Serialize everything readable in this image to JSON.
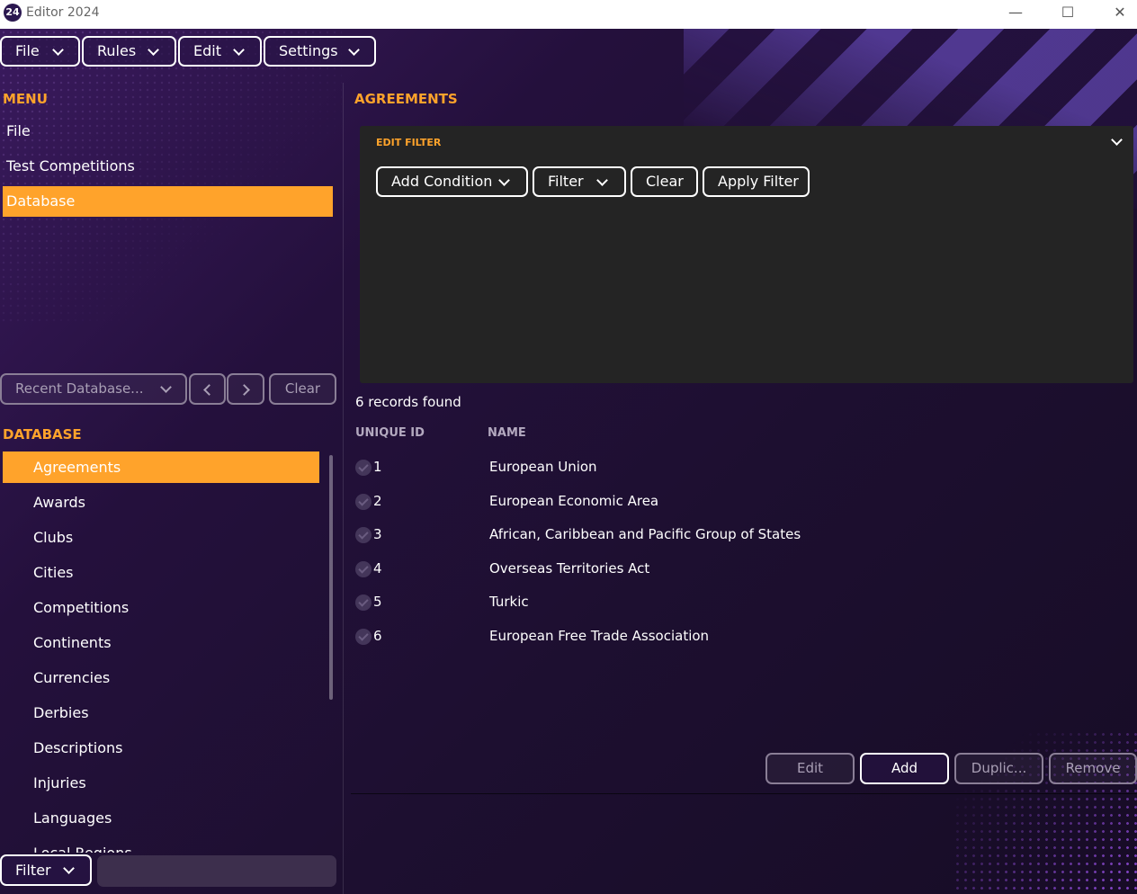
{
  "window": {
    "logo_text": "24",
    "title": "Editor 2024",
    "min_glyph": "—",
    "max_glyph": "☐",
    "close_glyph": "✕"
  },
  "menubar": {
    "items": [
      {
        "label": "File"
      },
      {
        "label": "Rules"
      },
      {
        "label": "Edit"
      },
      {
        "label": "Settings"
      }
    ]
  },
  "menu": {
    "heading": "MENU",
    "items": [
      {
        "label": "File",
        "active": false
      },
      {
        "label": "Test Competitions",
        "active": false
      },
      {
        "label": "Database",
        "active": true
      }
    ]
  },
  "recent": {
    "label": "Recent Database...",
    "clear_label": "Clear"
  },
  "database": {
    "heading": "DATABASE",
    "items": [
      {
        "label": "Agreements",
        "active": true
      },
      {
        "label": "Awards"
      },
      {
        "label": "Clubs"
      },
      {
        "label": "Cities"
      },
      {
        "label": "Competitions"
      },
      {
        "label": "Continents"
      },
      {
        "label": "Currencies"
      },
      {
        "label": "Derbies"
      },
      {
        "label": "Descriptions"
      },
      {
        "label": "Injuries"
      },
      {
        "label": "Languages"
      },
      {
        "label": "Local Regions"
      }
    ]
  },
  "bottom_filter": {
    "label": "Filter",
    "value": ""
  },
  "agreements": {
    "heading": "AGREEMENTS",
    "filter_panel": {
      "title": "EDIT FILTER",
      "add_condition": "Add Condition",
      "filter": "Filter",
      "clear": "Clear",
      "apply": "Apply Filter"
    },
    "records_found": "6 records found",
    "columns": [
      "UNIQUE ID",
      "NAME"
    ],
    "rows": [
      {
        "id": "1",
        "name": "European Union"
      },
      {
        "id": "2",
        "name": "European Economic Area"
      },
      {
        "id": "3",
        "name": "African, Caribbean and Pacific Group of States"
      },
      {
        "id": "4",
        "name": "Overseas Territories Act"
      },
      {
        "id": "5",
        "name": "Turkic"
      },
      {
        "id": "6",
        "name": "European Free Trade Association"
      }
    ],
    "actions": {
      "edit": "Edit",
      "add": "Add",
      "duplicate": "Duplic...",
      "remove": "Remove"
    }
  },
  "colors": {
    "accent": "#ffa32b",
    "panel": "#242424",
    "background": "#1d1128"
  }
}
